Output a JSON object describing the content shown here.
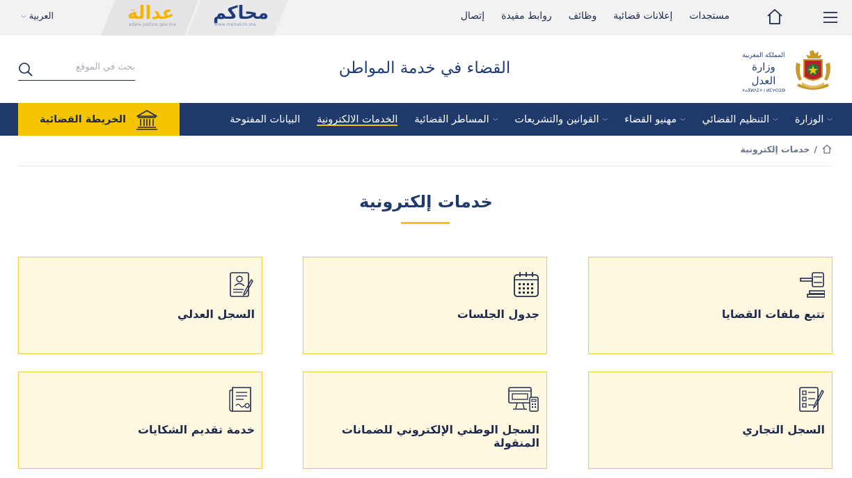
{
  "topbar": {
    "language": "العربية",
    "logos": {
      "adala": "عدالة",
      "adala_url": "adala.justice.gov.ma",
      "mahakim": "محاكم",
      "mahakim_url": "www.mahakim.ma"
    },
    "links": [
      "مستجدات",
      "إعلانات قضائية",
      "وظائف",
      "روابط مفيدة",
      "إتصال"
    ]
  },
  "header": {
    "search_placeholder": "بحث في الموقع",
    "slogan": "القضاء في خدمة المواطن",
    "ministry": {
      "line1": "المملكة المغربية",
      "line2": "وزارة العدل",
      "line3": "ⵜⴰⴳⵍⴷⵉⵜ ⵏ ⵍⵎⵖⵔⵉⴱ"
    }
  },
  "nav": {
    "items": [
      {
        "label": "الوزارة",
        "dropdown": true
      },
      {
        "label": "التنظيم القضائي",
        "dropdown": true
      },
      {
        "label": "مهنيو القضاء",
        "dropdown": true
      },
      {
        "label": "القوانين والتشريعات",
        "dropdown": true
      },
      {
        "label": "المساطر القضائية",
        "dropdown": true
      },
      {
        "label": "الخدمات الالكترونية",
        "dropdown": false,
        "active": true
      },
      {
        "label": "البيانات المفتوحة",
        "dropdown": false
      }
    ],
    "map_button": "الخريطة القضائية"
  },
  "breadcrumb": {
    "separator": "/",
    "current": "خدمات إلكترونية"
  },
  "page": {
    "title": "خدمات إلكترونية"
  },
  "services": [
    {
      "label": "تتبع ملفات القضايا",
      "icon": "gavel-icon"
    },
    {
      "label": "جدول الجلسات",
      "icon": "calendar-icon"
    },
    {
      "label": "السجل العدلي",
      "icon": "certificate-icon"
    },
    {
      "label": "السجل التجاري",
      "icon": "checklist-icon"
    },
    {
      "label": "السجل الوطني الإلكتروني للضمانات المنقولة",
      "icon": "computer-register-icon"
    },
    {
      "label": "خدمة تقديم الشكايات",
      "icon": "complaint-document-icon"
    }
  ],
  "colors": {
    "navy": "#1f3a6a",
    "gold": "#f5c400",
    "card_bg": "#fff8e1",
    "card_border": "#f2c74a"
  }
}
